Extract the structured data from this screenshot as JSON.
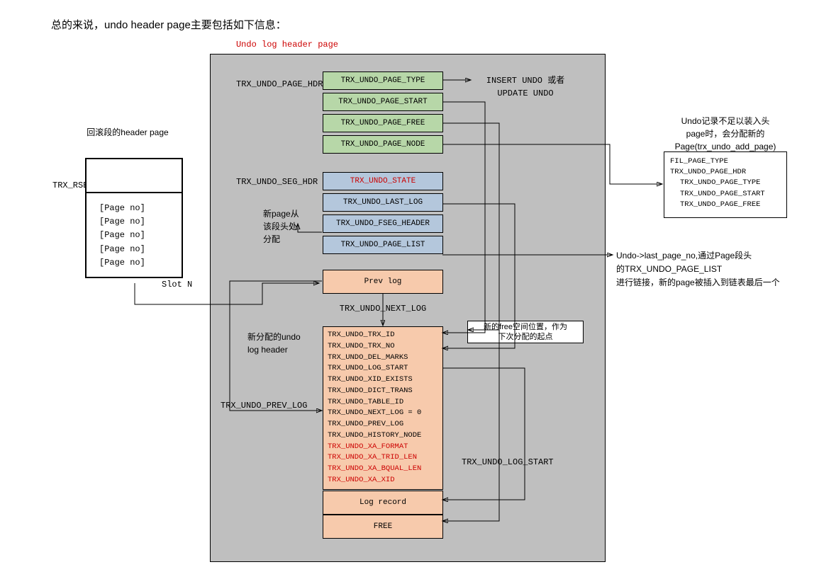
{
  "title": "总的来说，undo header page主要包括如下信息：",
  "caption": "Undo log header page",
  "labels": {
    "rseg_caption": "回滚段的header page",
    "trx_rseg": "TRX_RSEG",
    "slot_n": "Slot N",
    "page_hdr_lbl": "TRX_UNDO_PAGE_HDR",
    "seg_hdr_lbl": "TRX_UNDO_SEG_HDR",
    "new_page_lbl": "新page从\n该段头处\n分配",
    "new_loghdr_lbl": "新分配的undo\nlog header",
    "prev_log_lbl": "TRX_UNDO_PREV_LOG",
    "next_log_lbl": "TRX_UNDO_NEXT_LOG",
    "insert_update_lbl": "INSERT UNDO 或者\nUPDATE UNDO",
    "log_start_lbl": "TRX_UNDO_LOG_START",
    "free_pos_lbl": "新的free空间位置，作为\n下次分配的起点",
    "add_page_caption": "Undo记录不足以装入头\npage时，会分配新的\nPage(trx_undo_add_page)",
    "last_page_lbl": "Undo->last_page_no,通过Page段头\n的TRX_UNDO_PAGE_LIST\n进行链接，新的page被插入到链表最后一个"
  },
  "rseg_slots": [
    "[Page no]",
    "[Page no]",
    "[Page no]",
    "[Page no]",
    "[Page no]"
  ],
  "page_hdr_rows": [
    "TRX_UNDO_PAGE_TYPE",
    "TRX_UNDO_PAGE_START",
    "TRX_UNDO_PAGE_FREE",
    "TRX_UNDO_PAGE_NODE"
  ],
  "seg_hdr_rows": [
    {
      "t": "TRX_UNDO_STATE",
      "red": true
    },
    {
      "t": "TRX_UNDO_LAST_LOG",
      "red": false
    },
    {
      "t": "TRX_UNDO_FSEG_HEADER",
      "red": false
    },
    {
      "t": "TRX_UNDO_PAGE_LIST",
      "red": false
    }
  ],
  "prev_log": "Prev log",
  "log_hdr_rows": [
    {
      "t": "TRX_UNDO_TRX_ID",
      "red": false
    },
    {
      "t": "TRX_UNDO_TRX_NO",
      "red": false
    },
    {
      "t": "TRX_UNDO_DEL_MARKS",
      "red": false
    },
    {
      "t": "TRX_UNDO_LOG_START",
      "red": false
    },
    {
      "t": "TRX_UNDO_XID_EXISTS",
      "red": false
    },
    {
      "t": "TRX_UNDO_DICT_TRANS",
      "red": false
    },
    {
      "t": "TRX_UNDO_TABLE_ID",
      "red": false
    },
    {
      "t": "TRX_UNDO_NEXT_LOG = 0",
      "red": false
    },
    {
      "t": "TRX_UNDO_PREV_LOG",
      "red": false
    },
    {
      "t": "TRX_UNDO_HISTORY_NODE",
      "red": false
    },
    {
      "t": "TRX_UNDO_XA_FORMAT",
      "red": true
    },
    {
      "t": "TRX_UNDO_XA_TRID_LEN",
      "red": true
    },
    {
      "t": "TRX_UNDO_XA_BQUAL_LEN",
      "red": true
    },
    {
      "t": "TRX_UNDO_XA_XID",
      "red": true
    }
  ],
  "tail_rows": [
    "Log record",
    "FREE"
  ],
  "add_page_rows": [
    {
      "t": "FIL_PAGE_TYPE",
      "indent": 0
    },
    {
      "t": "TRX_UNDO_PAGE_HDR",
      "indent": 0
    },
    {
      "t": "TRX_UNDO_PAGE_TYPE",
      "indent": 1
    },
    {
      "t": "TRX_UNDO_PAGE_START",
      "indent": 1
    },
    {
      "t": "TRX_UNDO_PAGE_FREE",
      "indent": 1
    }
  ]
}
